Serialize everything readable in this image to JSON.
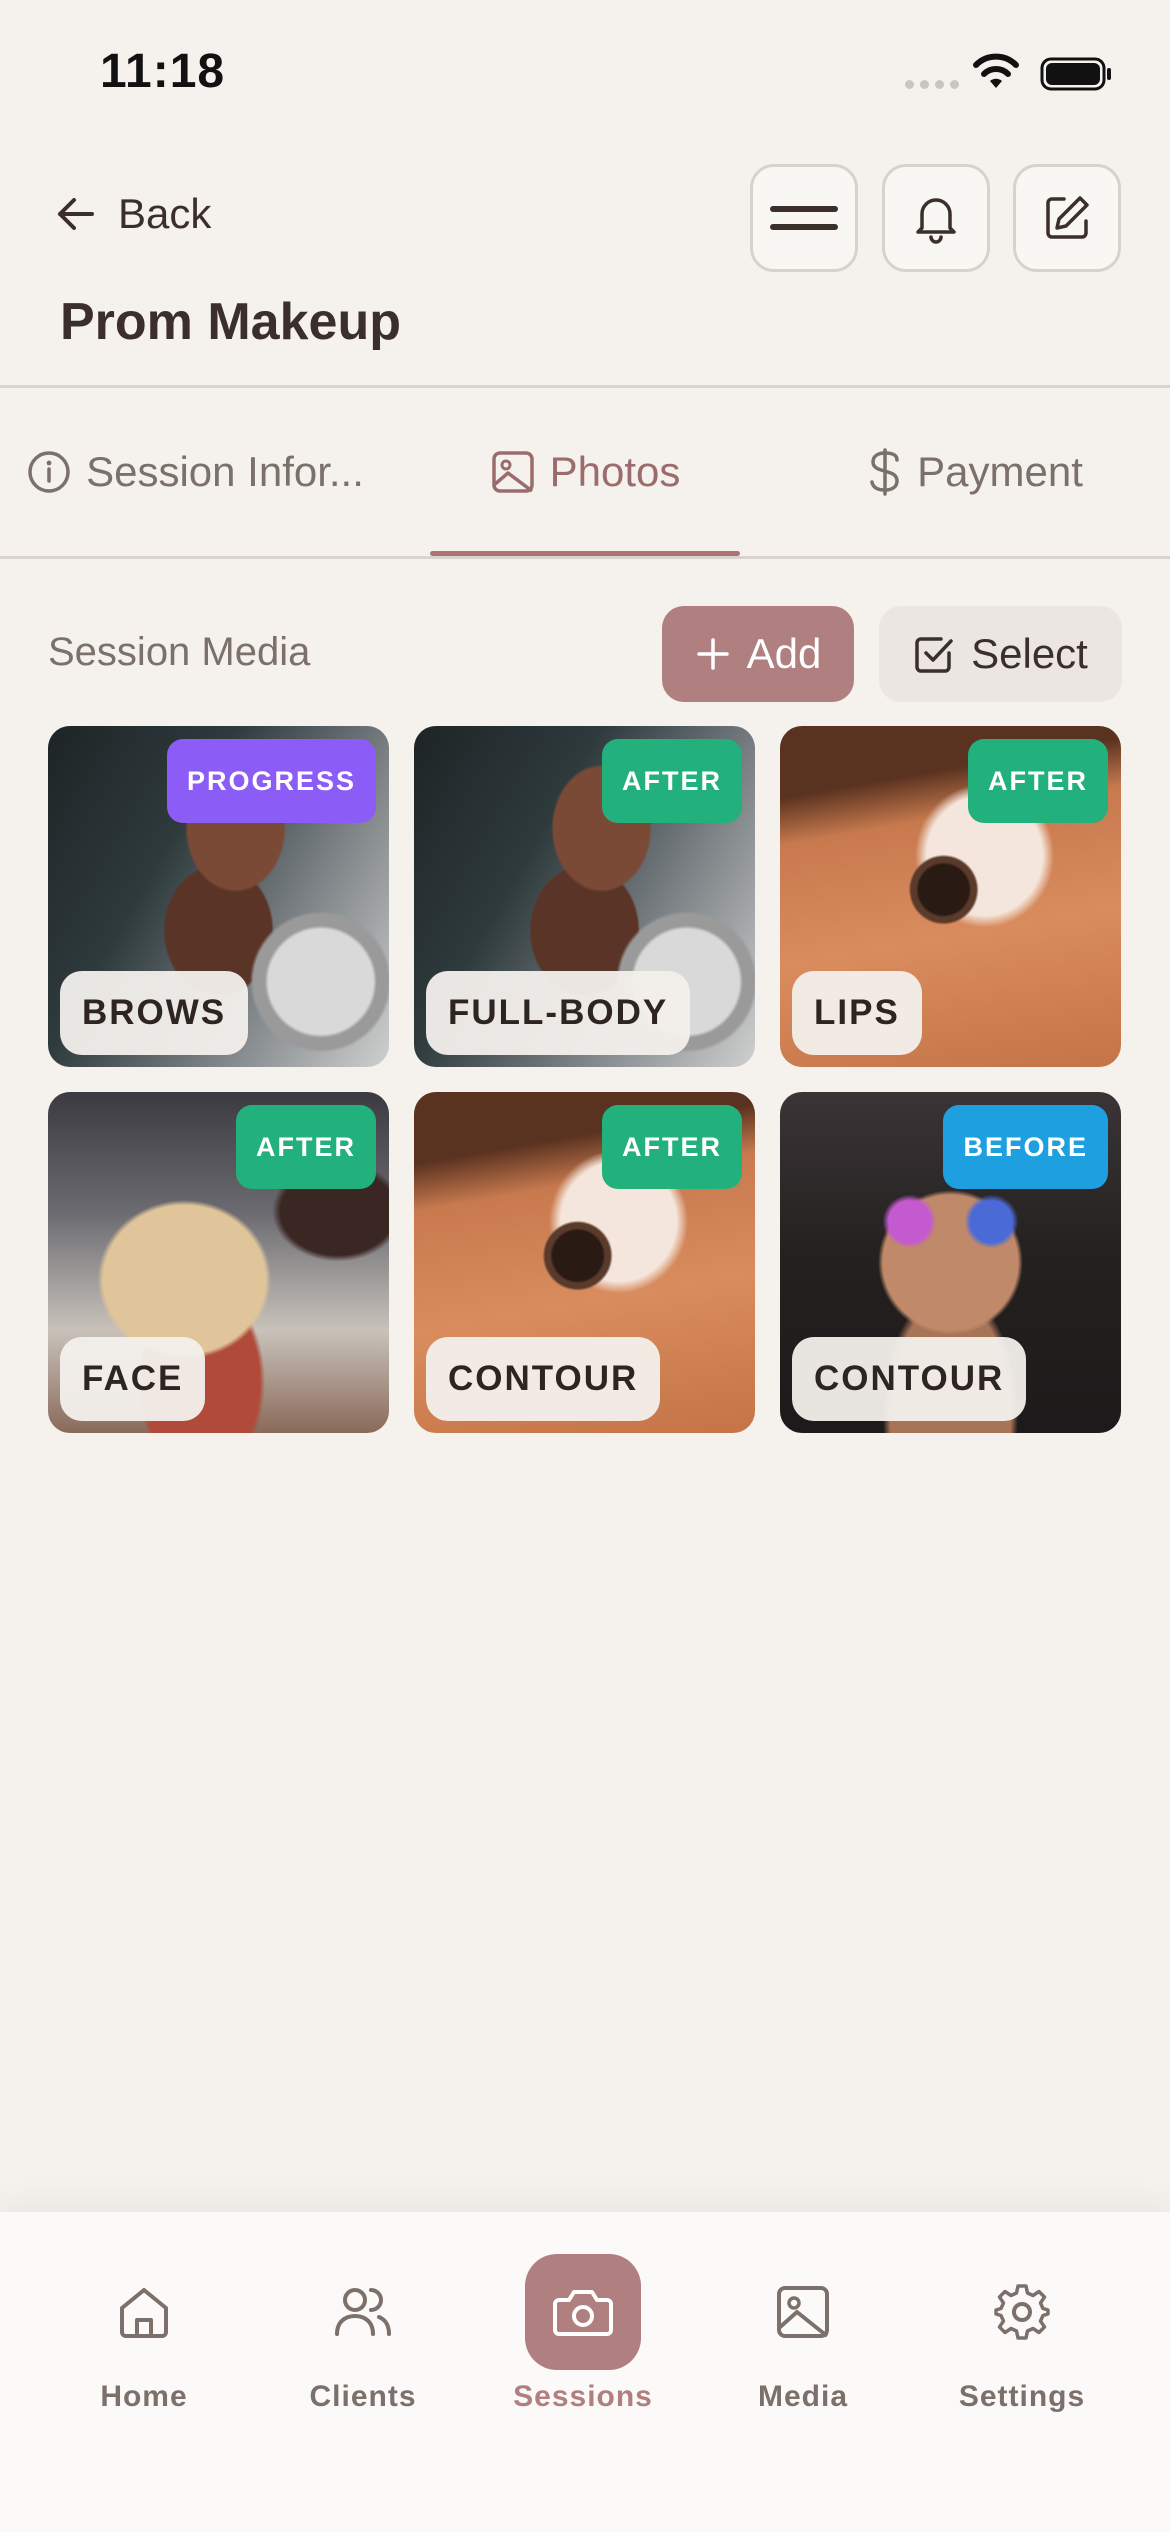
{
  "status": {
    "time": "11:18"
  },
  "header": {
    "back_label": "Back",
    "title": "Prom Makeup"
  },
  "tabs": [
    {
      "label": "Session Infor...",
      "icon": "info-icon",
      "active": false
    },
    {
      "label": "Photos",
      "icon": "image-icon",
      "active": true
    },
    {
      "label": "Payment",
      "icon": "dollar-icon",
      "active": false
    }
  ],
  "media": {
    "title": "Session Media",
    "add_label": "Add",
    "select_label": "Select",
    "items": [
      {
        "badge": "PROGRESS",
        "badge_color": "#8b5cf6",
        "label": "BROWS"
      },
      {
        "badge": "AFTER",
        "badge_color": "#22b07d",
        "label": "FULL-BODY"
      },
      {
        "badge": "AFTER",
        "badge_color": "#22b07d",
        "label": "LIPS"
      },
      {
        "badge": "AFTER",
        "badge_color": "#22b07d",
        "label": "FACE"
      },
      {
        "badge": "AFTER",
        "badge_color": "#22b07d",
        "label": "CONTOUR"
      },
      {
        "badge": "BEFORE",
        "badge_color": "#1ea0e0",
        "label": "CONTOUR"
      }
    ]
  },
  "nav": [
    {
      "label": "Home",
      "icon": "home-icon"
    },
    {
      "label": "Clients",
      "icon": "users-icon"
    },
    {
      "label": "Sessions",
      "icon": "camera-icon",
      "active": true
    },
    {
      "label": "Media",
      "icon": "image-icon"
    },
    {
      "label": "Settings",
      "icon": "gear-icon"
    }
  ],
  "colors": {
    "accent": "#b08080",
    "background": "#f5f2ee"
  }
}
